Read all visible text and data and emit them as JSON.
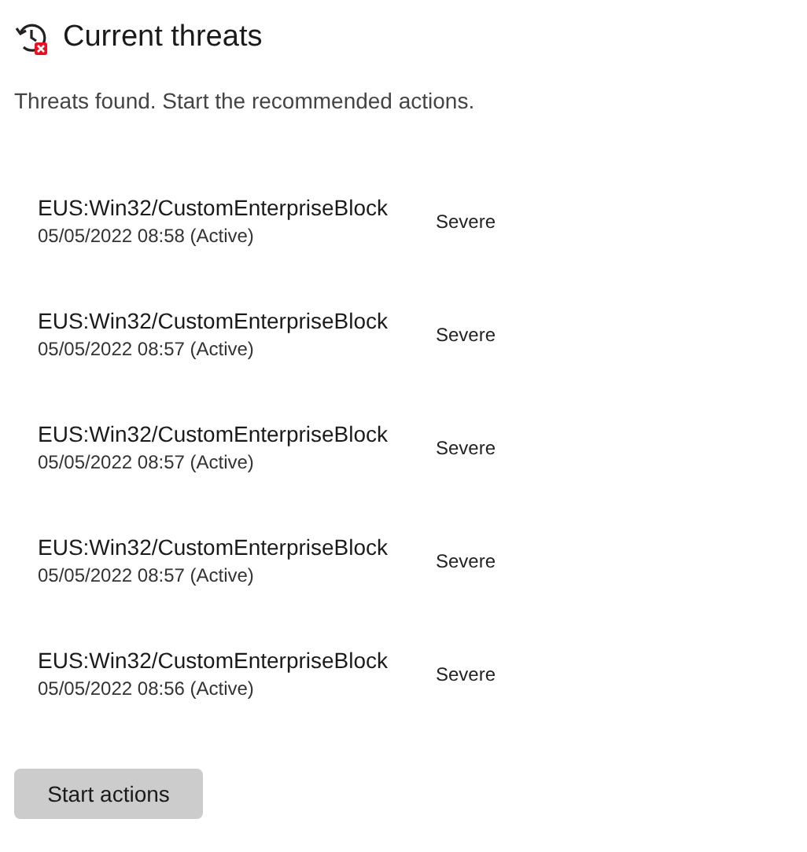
{
  "header": {
    "title": "Current threats",
    "subtitle": "Threats found. Start the recommended actions."
  },
  "threats": [
    {
      "name": "EUS:Win32/CustomEnterpriseBlock",
      "detected": "05/05/2022 08:58 (Active)",
      "severity": "Severe"
    },
    {
      "name": "EUS:Win32/CustomEnterpriseBlock",
      "detected": "05/05/2022 08:57 (Active)",
      "severity": "Severe"
    },
    {
      "name": "EUS:Win32/CustomEnterpriseBlock",
      "detected": "05/05/2022 08:57 (Active)",
      "severity": "Severe"
    },
    {
      "name": "EUS:Win32/CustomEnterpriseBlock",
      "detected": "05/05/2022 08:57 (Active)",
      "severity": "Severe"
    },
    {
      "name": "EUS:Win32/CustomEnterpriseBlock",
      "detected": "05/05/2022 08:56 (Active)",
      "severity": "Severe"
    }
  ],
  "button": {
    "label": "Start actions"
  }
}
